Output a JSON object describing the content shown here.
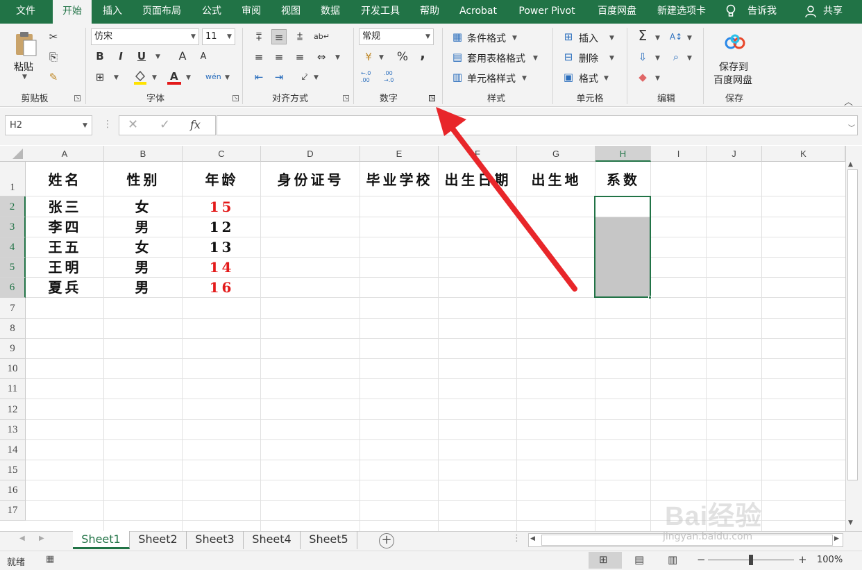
{
  "menu": {
    "tabs": [
      "文件",
      "开始",
      "插入",
      "页面布局",
      "公式",
      "审阅",
      "视图",
      "数据",
      "开发工具",
      "帮助",
      "Acrobat",
      "Power Pivot",
      "百度网盘",
      "新建选项卡"
    ],
    "active": "开始",
    "tell_me": "告诉我",
    "share": "共享"
  },
  "ribbon": {
    "clipboard": {
      "paste": "粘贴",
      "label": "剪贴板"
    },
    "font": {
      "name": "仿宋",
      "size": "11",
      "bold": "B",
      "italic": "I",
      "underline": "U",
      "grow": "A",
      "shrink": "A",
      "label": "字体"
    },
    "alignment": {
      "label": "对齐方式"
    },
    "number": {
      "format": "常规",
      "percent": "%",
      "comma": ",",
      "inc_decimal": "←.0 .00",
      "dec_decimal": ".00 →.0",
      "label": "数字"
    },
    "styles": {
      "conditional": "条件格式",
      "table": "套用表格格式",
      "cell_styles": "单元格样式",
      "label": "样式"
    },
    "cells": {
      "insert": "插入",
      "delete": "删除",
      "format": "格式",
      "label": "单元格"
    },
    "editing": {
      "label": "编辑"
    },
    "save": {
      "line1": "保存到",
      "line2": "百度网盘",
      "label": "保存"
    }
  },
  "formula_bar": {
    "name_box": "H2",
    "fx": "fx",
    "value": ""
  },
  "sheet": {
    "columns": [
      "A",
      "B",
      "C",
      "D",
      "E",
      "F",
      "G",
      "H",
      "I",
      "J",
      "K"
    ],
    "rows": [
      "1",
      "2",
      "3",
      "4",
      "5",
      "6",
      "7",
      "8",
      "9",
      "10",
      "11",
      "12",
      "13",
      "14",
      "15",
      "16",
      "17"
    ],
    "header_row": [
      "姓名",
      "性别",
      "年龄",
      "身份证号",
      "毕业学校",
      "出生日期",
      "出生地",
      "系数"
    ],
    "data": [
      {
        "name": "张三",
        "gender": "女",
        "age": "15",
        "age_red": true
      },
      {
        "name": "李四",
        "gender": "男",
        "age": "12",
        "age_red": false
      },
      {
        "name": "王五",
        "gender": "女",
        "age": "13",
        "age_red": false
      },
      {
        "name": "王明",
        "gender": "男",
        "age": "14",
        "age_red": true
      },
      {
        "name": "夏兵",
        "gender": "男",
        "age": "16",
        "age_red": true
      }
    ],
    "selected_column": "H",
    "selected_range": "H2:H6"
  },
  "sheet_tabs": [
    "Sheet1",
    "Sheet2",
    "Sheet3",
    "Sheet4",
    "Sheet5"
  ],
  "active_sheet": "Sheet1",
  "status": {
    "ready": "就绪",
    "zoom": "100%"
  },
  "watermark": {
    "text": "Bai经验",
    "url": "jingyan.baidu.com"
  },
  "colors": {
    "brand": "#217346",
    "red_text": "#e31a1a",
    "arrow": "#e8262a",
    "selection": "#c6c6c6"
  }
}
